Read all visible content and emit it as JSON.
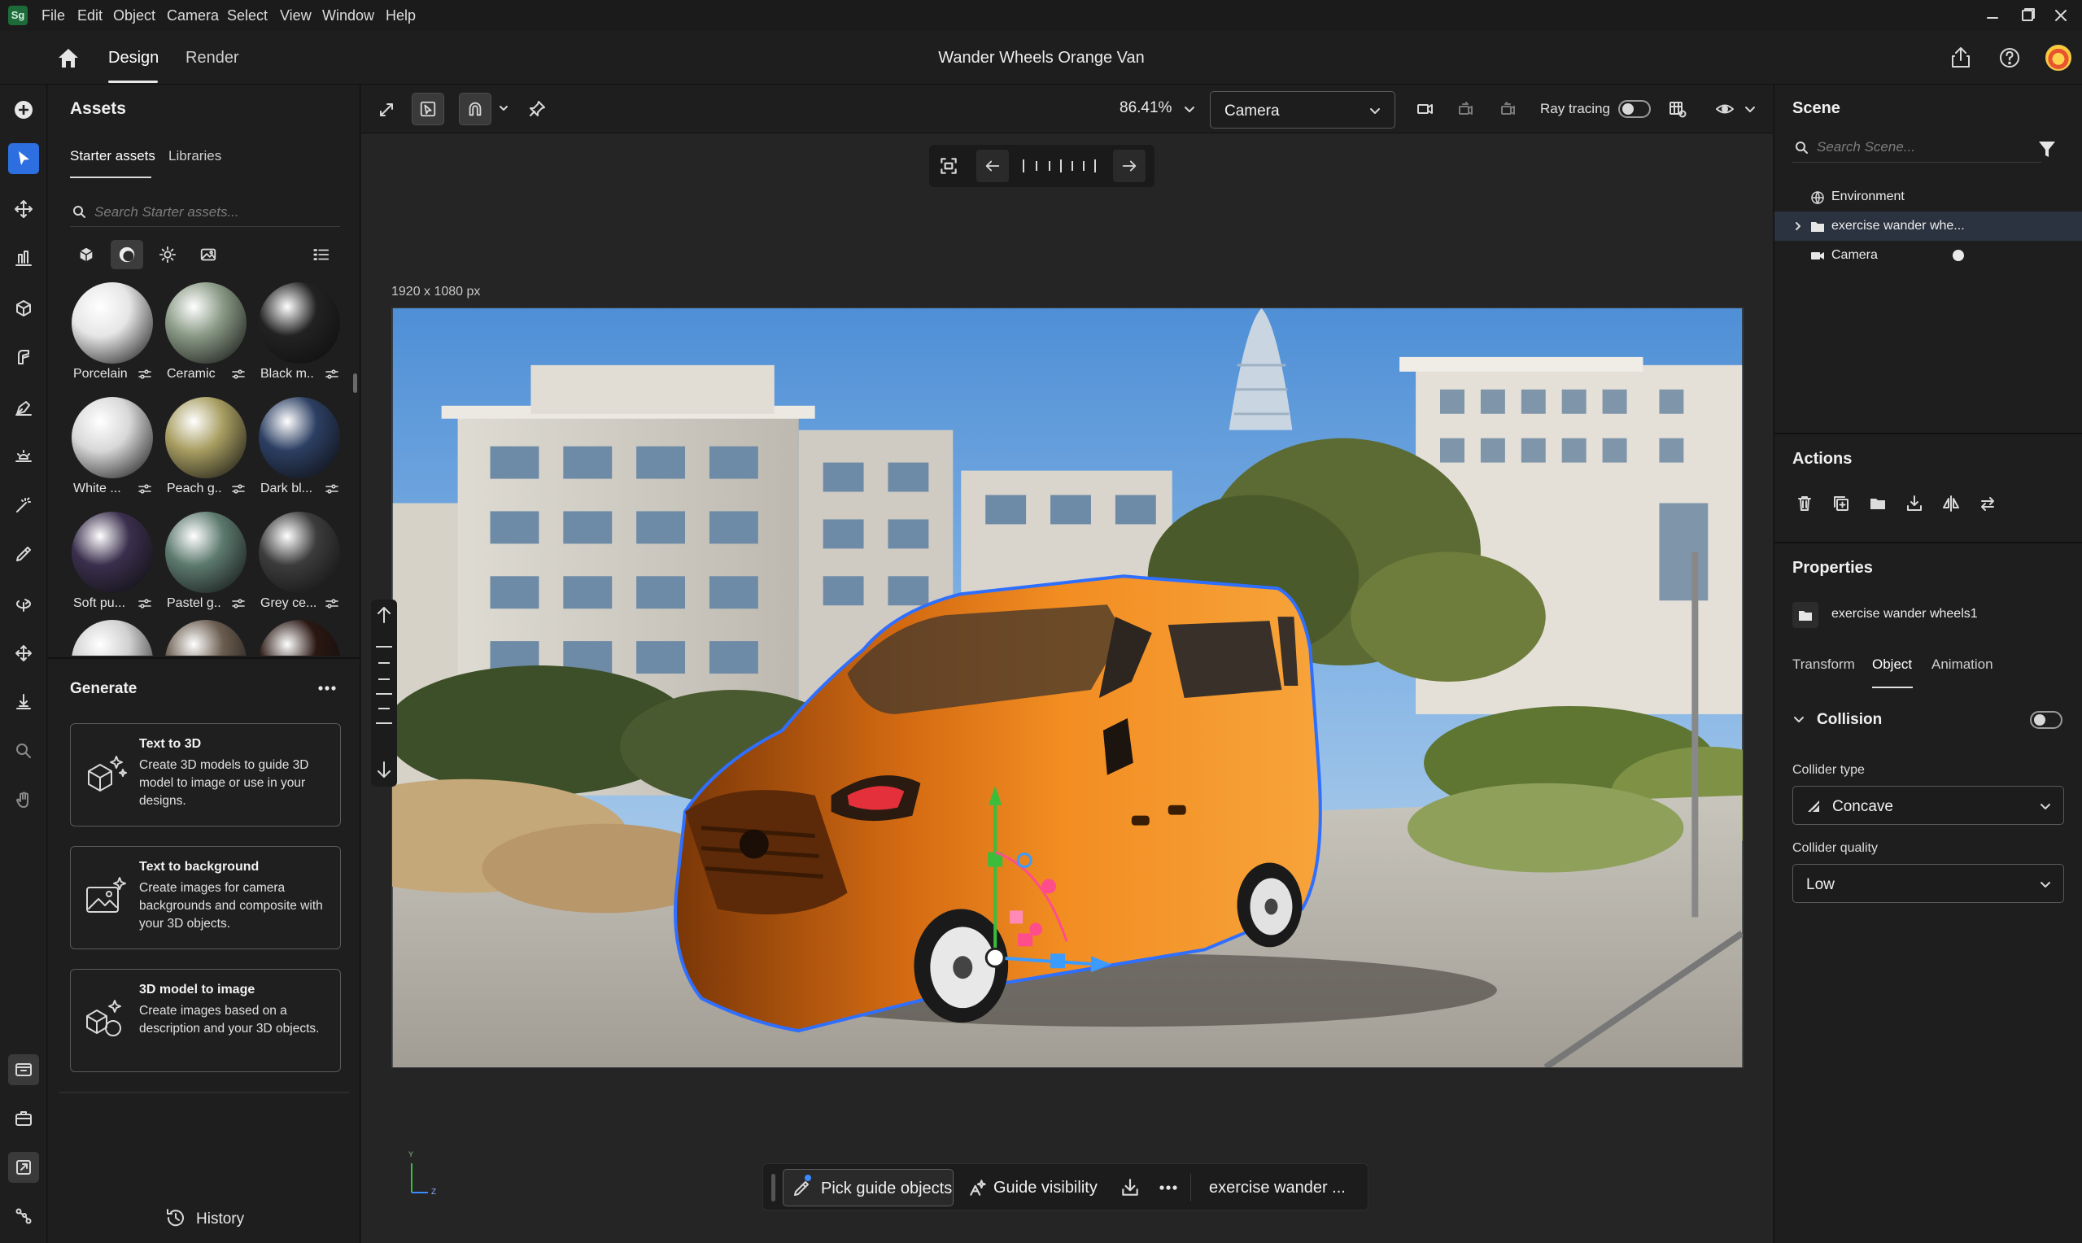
{
  "app": {
    "logo": "Sg",
    "menu": [
      "File",
      "Edit",
      "Object",
      "Camera",
      "Select",
      "View",
      "Window",
      "Help"
    ]
  },
  "header": {
    "tabs": [
      "Design",
      "Render"
    ],
    "title": "Wander Wheels Orange Van"
  },
  "assets": {
    "title": "Assets",
    "tabs": [
      "Starter assets",
      "Libraries"
    ],
    "search_placeholder": "Search Starter assets...",
    "materials": [
      {
        "label": "Porcelain",
        "color": "#e6e6e6"
      },
      {
        "label": "Ceramic",
        "color": "#8a9a86"
      },
      {
        "label": "Black m..",
        "color": "#222222"
      },
      {
        "label": "White ...",
        "color": "#d8d8d8"
      },
      {
        "label": "Peach g..",
        "color": "#a89e62"
      },
      {
        "label": "Dark bl...",
        "color": "#2c3f63"
      },
      {
        "label": "Soft pu...",
        "color": "#3a2f4d"
      },
      {
        "label": "Pastel g..",
        "color": "#5d7a6f"
      },
      {
        "label": "Grey ce...",
        "color": "#3c3c3c"
      }
    ],
    "partial_row_colors": [
      "#d0d0d0",
      "#6b5d50",
      "#2a1712"
    ]
  },
  "generate": {
    "title": "Generate",
    "cards": [
      {
        "title": "Text to 3D",
        "desc": "Create 3D models to guide 3D model to image or use in your designs."
      },
      {
        "title": "Text to background",
        "desc": "Create images for camera backgrounds and composite with your 3D objects."
      },
      {
        "title": "3D model to image",
        "desc": "Create images based on a description and your 3D objects."
      }
    ],
    "history_label": "History"
  },
  "toolbar": {
    "zoom": "86.41%",
    "camera": "Camera",
    "ray_tracing_label": "Ray tracing",
    "ray_tracing_on": false
  },
  "viewport": {
    "resolution": "1920 x 1080 px",
    "axis_y": "Y",
    "axis_z": "Z"
  },
  "bottom_bar": {
    "pick_guide": "Pick guide objects",
    "guide_visibility": "Guide visibility",
    "object_name": "exercise wander ..."
  },
  "scene": {
    "title": "Scene",
    "search_placeholder": "Search Scene...",
    "items": [
      "Environment",
      "exercise wander whe...",
      "Camera"
    ]
  },
  "actions": {
    "title": "Actions"
  },
  "properties": {
    "title": "Properties",
    "object_name": "exercise wander wheels1",
    "tabs": [
      "Transform",
      "Object",
      "Animation"
    ],
    "collision_label": "Collision",
    "collision_on": false,
    "collider_type_label": "Collider type",
    "collider_type_value": "Concave",
    "collider_quality_label": "Collider quality",
    "collider_quality_value": "Low"
  },
  "colors": {
    "accent": "#2d6fe0",
    "van_orange": "#f08a1e",
    "selection_outline": "#2f6fff"
  }
}
